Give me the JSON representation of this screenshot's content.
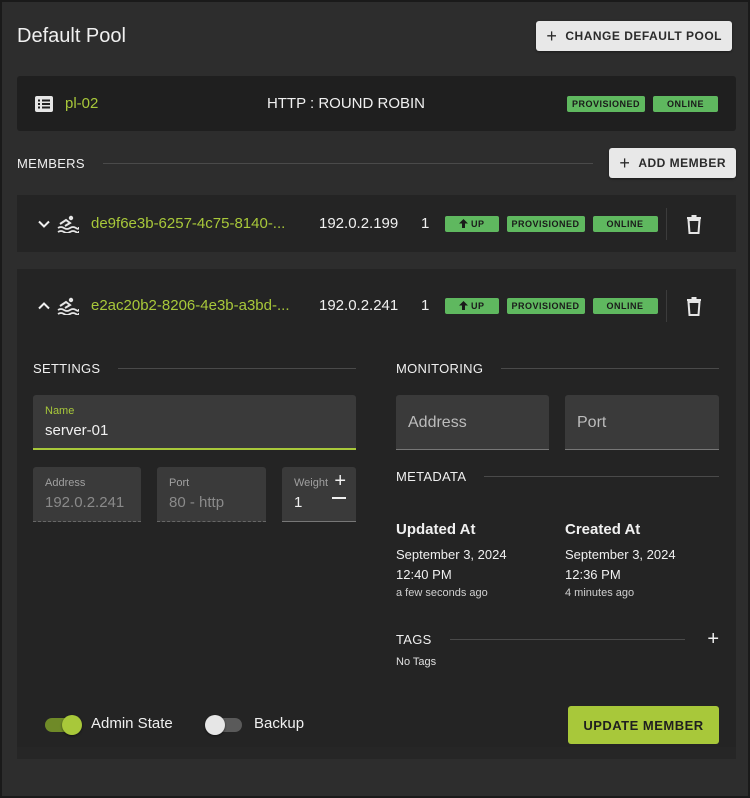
{
  "header": {
    "title": "Default Pool",
    "change_button": "CHANGE DEFAULT POOL"
  },
  "pool": {
    "name": "pl-02",
    "protocol": "HTTP : ROUND ROBIN",
    "badges": [
      "PROVISIONED",
      "ONLINE"
    ]
  },
  "members_section": {
    "label": "MEMBERS",
    "add_button": "ADD MEMBER"
  },
  "members": [
    {
      "name": "de9f6e3b-6257-4c75-8140-...",
      "ip": "192.0.2.199",
      "weight": "1",
      "status": "UP",
      "provisioning": "PROVISIONED",
      "operating": "ONLINE"
    },
    {
      "name": "e2ac20b2-8206-4e3b-a3bd-...",
      "ip": "192.0.2.241",
      "weight": "1",
      "status": "UP",
      "provisioning": "PROVISIONED",
      "operating": "ONLINE"
    }
  ],
  "settings": {
    "label": "SETTINGS",
    "name_label": "Name",
    "name_value": "server-01",
    "address_label": "Address",
    "address_value": "192.0.2.241",
    "port_label": "Port",
    "port_value": "80 - http",
    "weight_label": "Weight",
    "weight_value": "1"
  },
  "monitoring": {
    "label": "MONITORING",
    "address_placeholder": "Address",
    "port_placeholder": "Port"
  },
  "metadata": {
    "label": "METADATA",
    "updated": {
      "title": "Updated At",
      "date": "September 3, 2024",
      "time": "12:40 PM",
      "relative": "a few seconds ago"
    },
    "created": {
      "title": "Created At",
      "date": "September 3, 2024",
      "time": "12:36 PM",
      "relative": "4 minutes ago"
    }
  },
  "tags": {
    "label": "TAGS",
    "empty": "No Tags"
  },
  "footer": {
    "admin_state_label": "Admin State",
    "admin_state_on": true,
    "backup_label": "Backup",
    "backup_on": false,
    "update_button": "UPDATE MEMBER"
  },
  "colors": {
    "accent": "#a8c83a",
    "badge_green": "#5fb85f",
    "background": "#2d2d2d"
  }
}
